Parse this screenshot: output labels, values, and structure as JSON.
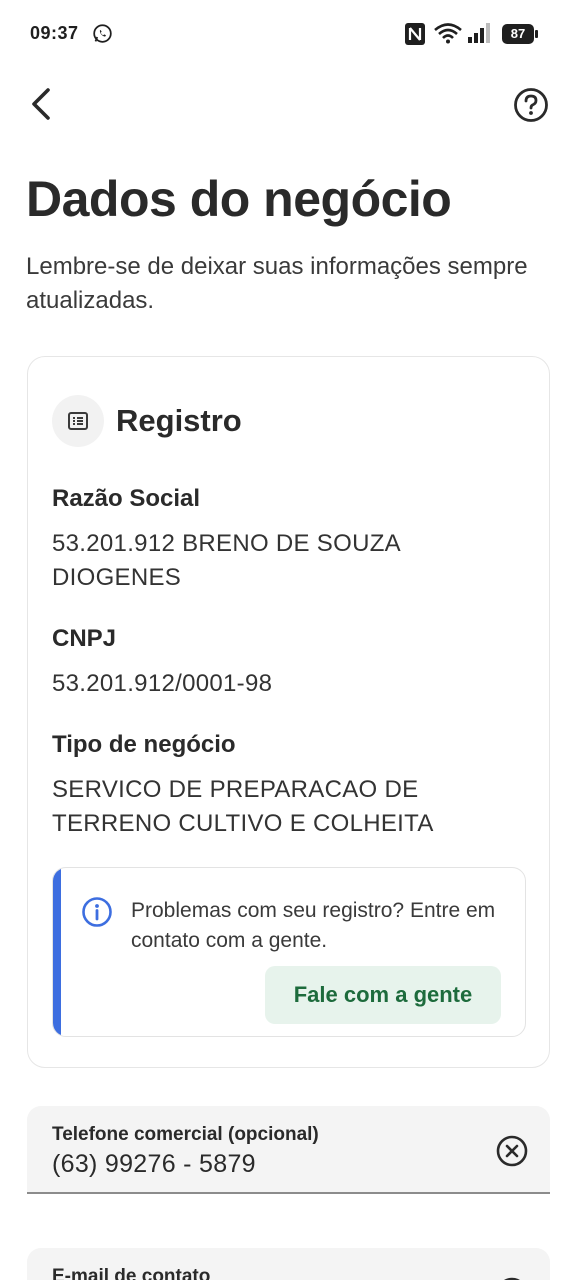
{
  "status_bar": {
    "time": "09:37",
    "battery": "87",
    "icons": [
      "whatsapp-icon",
      "nfc-icon",
      "wifi-icon",
      "signal-icon",
      "battery-icon"
    ]
  },
  "nav": {
    "back_icon": "chevron-left-icon",
    "help_icon": "help-circle-icon"
  },
  "header": {
    "title": "Dados do negócio",
    "subtitle": "Lembre-se de deixar suas informações sempre atualizadas."
  },
  "registro": {
    "icon": "document-list-icon",
    "title": "Registro",
    "fields": [
      {
        "label": "Razão Social",
        "value": "53.201.912 BRENO DE SOUZA DIOGENES"
      },
      {
        "label": "CNPJ",
        "value": "53.201.912/0001-98"
      },
      {
        "label": "Tipo de negócio",
        "value": "SERVICO DE PREPARACAO DE TERRENO CULTIVO E COLHEITA"
      }
    ],
    "banner": {
      "icon": "info-icon",
      "text": "Problemas com seu registro? Entre em contato com a gente.",
      "button_label": "Fale com a gente",
      "accent_color": "#3d6ee0"
    }
  },
  "inputs": {
    "phone": {
      "label": "Telefone comercial (opcional)",
      "value": "(63) 99276 - 5879",
      "clear_icon": "clear-circle-icon"
    },
    "email": {
      "label": "E-mail de contato",
      "clear_icon": "clear-circle-icon"
    }
  },
  "colors": {
    "button_bg": "#e7f3ec",
    "button_text": "#1d6b3c",
    "info_blue": "#3d6ee0"
  }
}
